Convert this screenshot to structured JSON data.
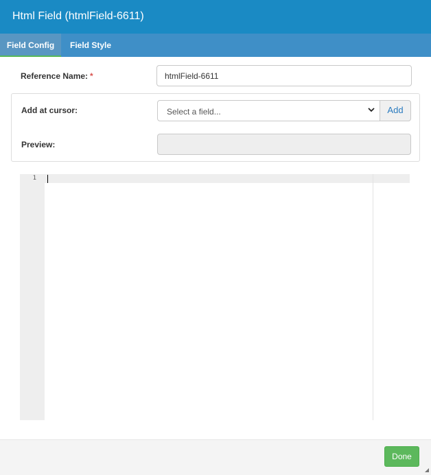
{
  "window": {
    "title": "Html Field (htmlField-6611)"
  },
  "tabs": [
    {
      "label": "Field Config",
      "active": true
    },
    {
      "label": "Field Style",
      "active": false
    }
  ],
  "form": {
    "reference_name_label": "Reference Name:",
    "required_mark": "*",
    "reference_name_value": "htmlField-6611",
    "add_at_cursor_label": "Add at cursor:",
    "field_select_value": "Select a field...",
    "add_button_label": "Add",
    "preview_label": "Preview:",
    "preview_value": ""
  },
  "editor": {
    "line_numbers": [
      "1"
    ],
    "content": ""
  },
  "footer": {
    "done_label": "Done"
  },
  "icons": {
    "dropdown": "chevron-down-icon",
    "resize": "resize-grip-icon"
  },
  "colors": {
    "titlebar": "#1a8ac4",
    "tabbar": "#3f8fc7",
    "done_button": "#5cb85c",
    "required": "#d9534f",
    "link": "#2a7bbf"
  }
}
